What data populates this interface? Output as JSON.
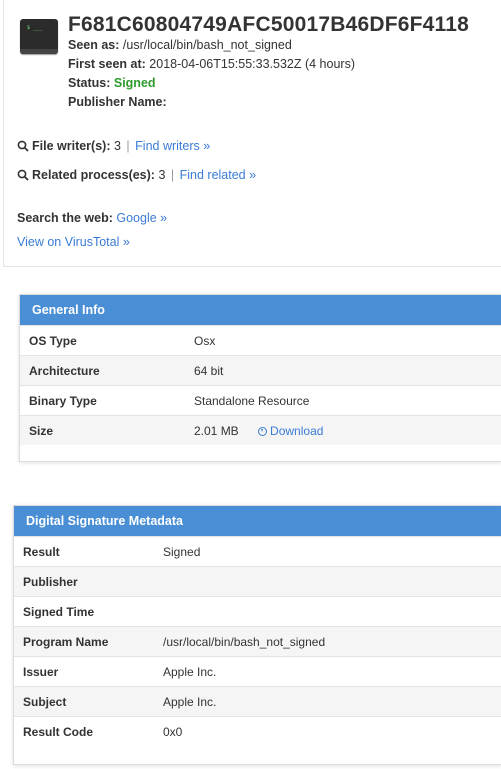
{
  "header": {
    "hash": "F681C60804749AFC50017B46DF6F4118",
    "seen_as_label": "Seen as:",
    "seen_as_value": "/usr/local/bin/bash_not_signed",
    "first_seen_label": "First seen at:",
    "first_seen_value": "2018-04-06T15:55:33.532Z (4 hours)",
    "status_label": "Status:",
    "status_value": "Signed",
    "publisher_label": "Publisher Name:",
    "icon": "terminal-icon",
    "icon_prompt": "$ ___"
  },
  "writers": {
    "label": "File writer(s):",
    "count": "3",
    "sep": "|",
    "link": "Find writers »"
  },
  "related": {
    "label": "Related process(es):",
    "count": "3",
    "sep": "|",
    "link": "Find related »"
  },
  "search": {
    "label": "Search the web:",
    "link": "Google »"
  },
  "virustotal": "View on VirusTotal »",
  "general_info": {
    "title": "General Info",
    "rows": [
      {
        "key": "OS Type",
        "value": "Osx"
      },
      {
        "key": "Architecture",
        "value": "64 bit"
      },
      {
        "key": "Binary Type",
        "value": "Standalone Resource"
      },
      {
        "key": "Size",
        "value": "2.01 MB"
      }
    ],
    "download": "Download"
  },
  "signature": {
    "title": "Digital Signature Metadata",
    "rows": [
      {
        "key": "Result",
        "value": "Signed"
      },
      {
        "key": "Publisher",
        "value": ""
      },
      {
        "key": "Signed Time",
        "value": ""
      },
      {
        "key": "Program Name",
        "value": "/usr/local/bin/bash_not_signed"
      },
      {
        "key": "Issuer",
        "value": "Apple Inc."
      },
      {
        "key": "Subject",
        "value": "Apple Inc."
      },
      {
        "key": "Result Code",
        "value": "0x0"
      }
    ]
  },
  "colors": {
    "accent": "#4a8fd6",
    "link": "#3a7bd5",
    "signed": "#2e9a2e"
  }
}
